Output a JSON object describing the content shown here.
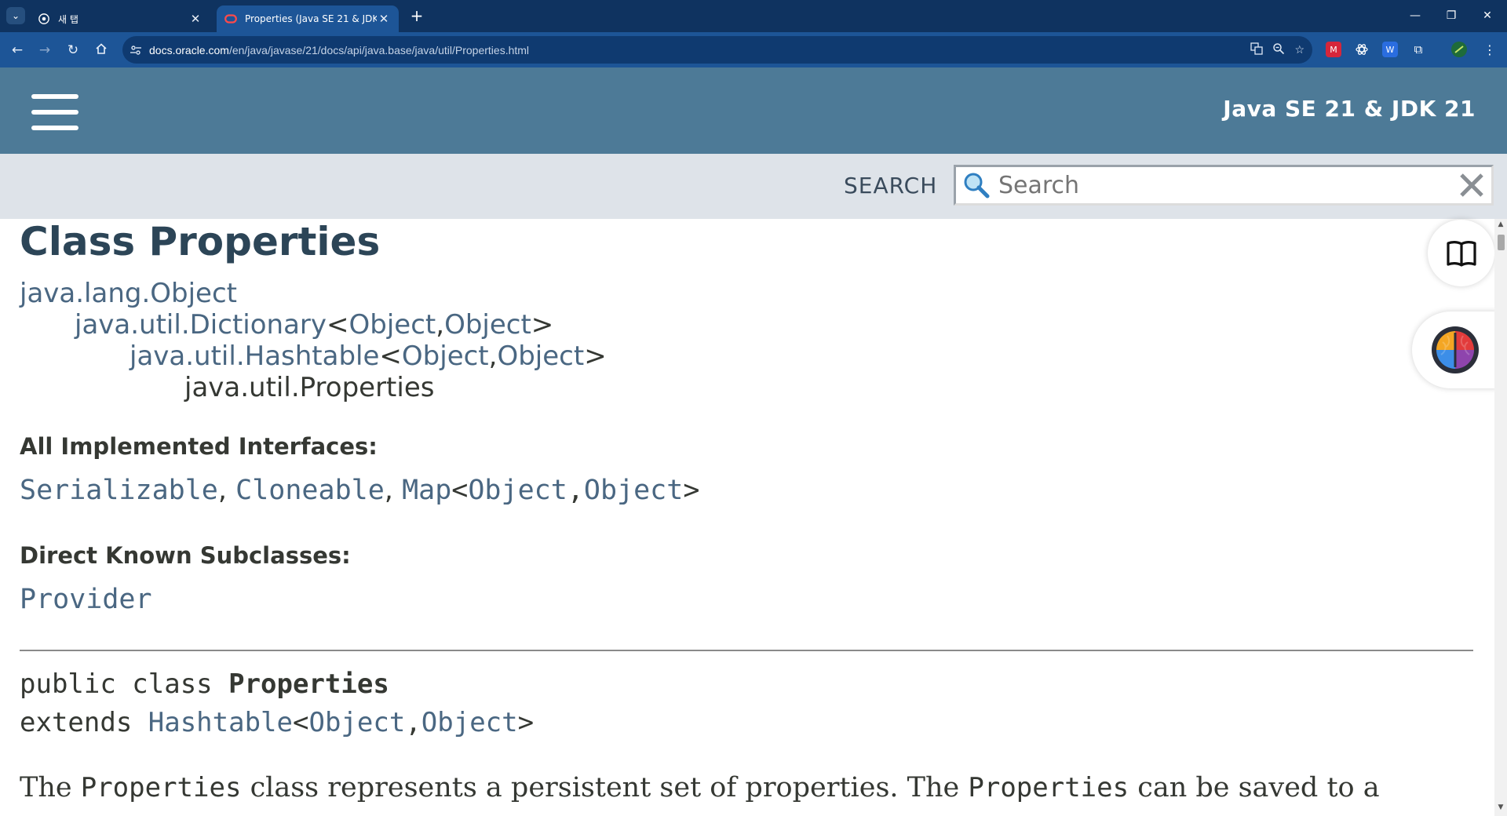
{
  "browser": {
    "tabs": [
      {
        "title": "새 탭",
        "active": false
      },
      {
        "title": "Properties (Java SE 21 & JDK 21)",
        "active": true
      }
    ],
    "url_host": "docs.oracle.com",
    "url_path": "/en/java/javase/21/docs/api/java.base/java/util/Properties.html"
  },
  "header": {
    "about_language": "Java SE 21 & JDK 21",
    "search_label": "SEARCH",
    "search_placeholder": "Search"
  },
  "page": {
    "title": "Class Properties",
    "inheritance": {
      "level0": "java.lang.Object",
      "level1_class": "java.util.Dictionary",
      "level1_lt": "<",
      "level1_arg1": "Object",
      "level1_comma": ",",
      "level1_arg2": "Object",
      "level1_gt": ">",
      "level2_class": "java.util.Hashtable",
      "level2_lt": "<",
      "level2_arg1": "Object",
      "level2_comma": ",",
      "level2_arg2": "Object",
      "level2_gt": ">",
      "level3": "java.util.Properties"
    },
    "interfaces_label": "All Implemented Interfaces:",
    "interfaces": {
      "serializable": "Serializable",
      "sep1": ", ",
      "cloneable": "Cloneable",
      "sep2": ", ",
      "map": "Map",
      "lt": "<",
      "arg1": "Object",
      "comma": ",",
      "arg2": "Object",
      "gt": ">"
    },
    "subclasses_label": "Direct Known Subclasses:",
    "subclass": "Provider",
    "signature": {
      "modifiers": "public class ",
      "name": "Properties",
      "extends_kw": "extends ",
      "superclass": "Hashtable",
      "lt": "<",
      "arg1": "Object",
      "comma": ",",
      "arg2": "Object",
      "gt": ">"
    },
    "description": {
      "part1": "The ",
      "code1": "Properties",
      "part2": " class represents a persistent set of properties. The ",
      "code2": "Properties",
      "part3": " can be saved to a"
    }
  }
}
